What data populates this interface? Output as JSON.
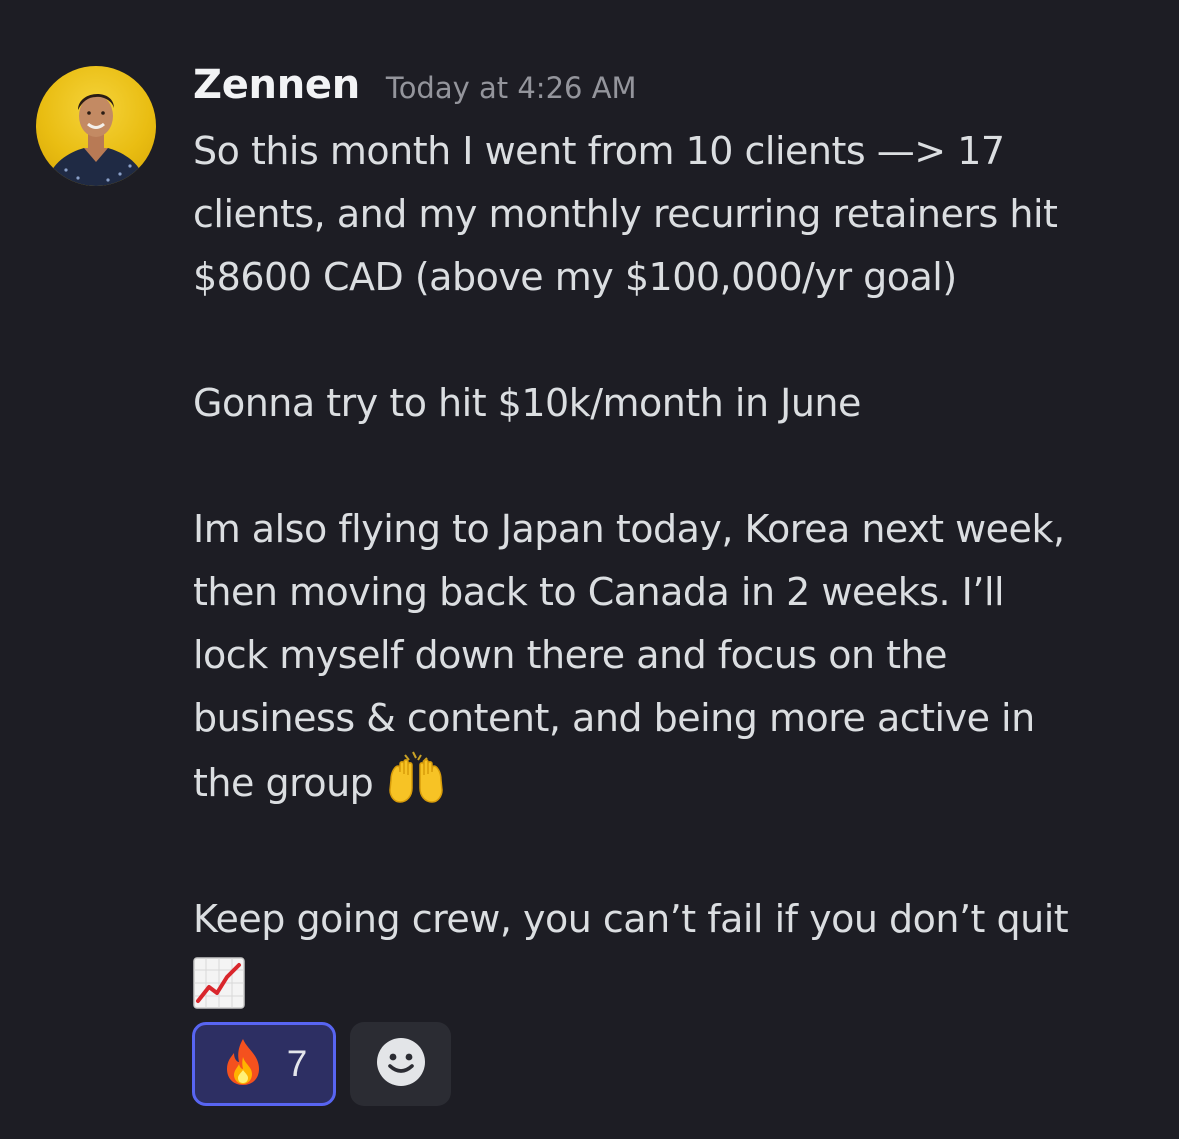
{
  "message": {
    "author": "Zennen",
    "timestamp": "Today at 4:26 AM",
    "avatar_icon": "user-avatar-photo",
    "paragraphs": [
      {
        "lines": [
          "So this month I went from 10 clients —> 17",
          "clients, and my monthly recurring retainers hit",
          "$8600 CAD (above my $100,000/yr goal)"
        ]
      },
      {
        "lines": [
          "Gonna try to hit $10k/month in June"
        ]
      },
      {
        "lines": [
          "Im also flying to Japan today, Korea next week,",
          "then moving back to Canada in 2 weeks. I’ll",
          "lock myself down there and focus on the",
          "business & content, and being more active in",
          "the group"
        ],
        "trailing_emoji": "raising-hands-emoji"
      },
      {
        "lines": [
          "Keep going crew, you can’t fail if you don’t quit"
        ],
        "trailing_emoji": "chart-increasing-emoji"
      }
    ]
  },
  "reactions": [
    {
      "emoji": "fire-emoji",
      "count": "7",
      "selected": true
    },
    {
      "emoji": "add-reaction-smiley-icon",
      "count": ""
    }
  ],
  "colors": {
    "background": "#1d1d24",
    "username": "#f2f3f5",
    "timestamp": "#94959c",
    "body_text": "#dbdee1",
    "reaction_selected_bg": "#2d2f63",
    "reaction_selected_border": "#5865f2",
    "reaction_add_bg": "#2b2c33"
  }
}
